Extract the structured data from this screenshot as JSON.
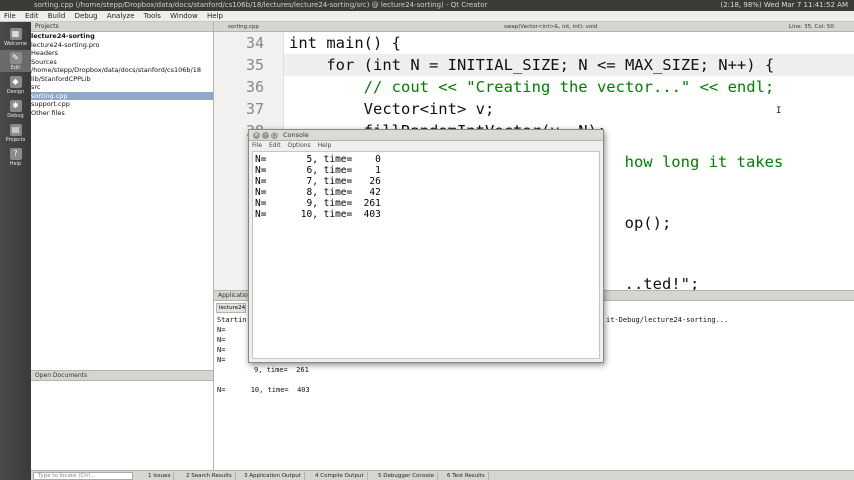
{
  "titlebar": {
    "title": "sorting.cpp (/home/stepp/Dropbox/data/docs/stanford/cs106b/18/lectures/lecture24-sorting/src) @ lecture24-sorting) - Qt Creator",
    "tray": "(2:18, 98%)   Wed Mar 7  11:41:52 AM"
  },
  "menu": [
    "File",
    "Edit",
    "Build",
    "Debug",
    "Analyze",
    "Tools",
    "Window",
    "Help"
  ],
  "modes": [
    {
      "label": "Welcome",
      "icon": "▦"
    },
    {
      "label": "Edit",
      "icon": "✎"
    },
    {
      "label": "Design",
      "icon": "◆"
    },
    {
      "label": "Debug",
      "icon": "✱"
    },
    {
      "label": "Projects",
      "icon": "▤"
    },
    {
      "label": "Help",
      "icon": "?"
    }
  ],
  "projects": {
    "header": "Projects",
    "tree": [
      "lecture24-sorting",
      "  lecture24-sorting.pro",
      "  Headers",
      "  Sources",
      "    /home/stepp/Dropbox/data/docs/stanford/cs106b/18",
      "      lib/StanfordCPPLib",
      "      src",
      "        sorting.cpp",
      "        support.cpp",
      "  Other files"
    ]
  },
  "open_documents": {
    "header": "Open Documents"
  },
  "editor": {
    "tab": "sorting.cpp",
    "function": "swap(Vector<int>&, int, int): void",
    "position": "Line: 35, Col: 50",
    "lines": [
      {
        "num": "34",
        "code": "int main() {"
      },
      {
        "num": "35",
        "code": "    for (int N = INITIAL_SIZE; N <= MAX_SIZE; N++) {"
      },
      {
        "num": "36",
        "code": "        // cout << \"Creating the vector...\" << endl;"
      },
      {
        "num": "37",
        "code": "        Vector<int> v;"
      },
      {
        "num": "38",
        "code": "        fillRandomIntVector(v, N);"
      },
      {
        "num": "",
        "code": "                    how long it takes"
      },
      {
        "num": "",
        "code": "                    op();"
      },
      {
        "num": "",
        "code": "                    ..ted!\";"
      }
    ]
  },
  "console": {
    "title": "Console",
    "menu": [
      "File",
      "Edit",
      "Options",
      "Help"
    ],
    "rows": [
      "N=       5, time=    0",
      "N=       6, time=    1",
      "N=       7, time=   26",
      "N=       8, time=   42",
      "N=       9, time=  261",
      "N=      10, time=  403"
    ]
  },
  "app_output": {
    "header": "Application Output",
    "tab": "lecture24...",
    "start_left": "Startin",
    "start_right": "it-Debug/lecture24-sorting...",
    "partial": [
      "N=",
      "N=",
      "N=",
      "N="
    ],
    "row9": "9, time=  261",
    "row10": "N=      10, time=  403"
  },
  "status": {
    "locate": "Type to locate (Ctrl...",
    "tabs": [
      "1 Issues",
      "2 Search Results",
      "3 Application Output",
      "4 Compile Output",
      "5 Debugger Console",
      "6 Test Results"
    ]
  }
}
